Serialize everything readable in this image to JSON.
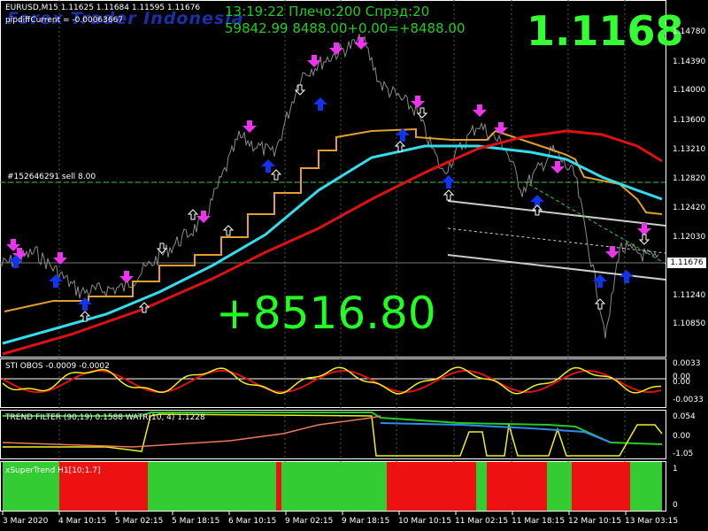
{
  "header": {
    "symbol_line": "EURUSD,M15  1.11625 1.11684 1.11595 1.11676",
    "pip_diff": "pipdiffCurrent = -0.00063667",
    "brand": "Forex Trader Indonesia",
    "info_time": "13:19:22 Плечо:200 Спрэд:20",
    "info_balance": "59842.99 8488.00+0.00=+8488.00",
    "big_price": "1.1168",
    "profit": "+8516.80",
    "order_label": "#152646291 sell 8.00"
  },
  "price_axis": {
    "labels": [
      "1.14780",
      "1.14390",
      "1.14000",
      "1.13600",
      "1.13210",
      "1.12820",
      "1.12420",
      "1.12030",
      "1.11676",
      "1.11240",
      "1.10850"
    ],
    "current": "1.11676"
  },
  "indicators": [
    {
      "name": "STI OBOS -0.0009 -0.0002",
      "axis": [
        "0.0033",
        "0.00",
        "0.00",
        "-0.0033"
      ]
    },
    {
      "name": "TREND FILTER (90,19) 0.1588  WATR(10, 4) 1.1228",
      "axis": [
        "0.054",
        "0.00",
        "-1.05"
      ]
    },
    {
      "name": "xSuperTrend H1[10;1.7]",
      "axis": [
        "1",
        "0"
      ]
    }
  ],
  "time_axis": [
    "3 Mar 2020",
    "4 Mar 10:15",
    "5 Mar 02:15",
    "5 Mar 18:15",
    "6 Mar 10:15",
    "9 Mar 02:15",
    "9 Mar 18:15",
    "10 Mar 10:15",
    "11 Mar 02:15",
    "11 Mar 18:15",
    "12 Mar 10:15",
    "13 Mar 03:15"
  ],
  "colors": {
    "background": "#000000",
    "price_line": "#8a8a8a",
    "sma_orange": "#e0a030",
    "ma_cyan": "#33ddee",
    "ma_red": "#dd1111",
    "sell_arrow": "#ee33ee",
    "buy_arrow": "#1133ee",
    "supertrend_up": "#33cc33",
    "supertrend_down": "#ee1111",
    "text_green": "#22cc22"
  },
  "supertrend_blocks": [
    "green",
    "red",
    "green",
    "red",
    "green",
    "red",
    "green",
    "red",
    "green",
    "red",
    "green"
  ]
}
